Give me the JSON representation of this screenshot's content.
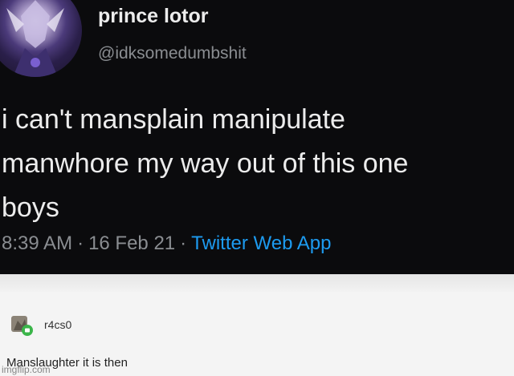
{
  "tweet": {
    "display_name": "prince lotor",
    "handle": "@idksomedumbshit",
    "text_lines": [
      "i can't mansplain manipulate",
      "manwhore my way out of this one",
      "boys"
    ],
    "time": "8:39 AM",
    "separator": "·",
    "date": "16 Feb 21",
    "source": "Twitter Web App",
    "avatar_icon": "profile-avatar-icon"
  },
  "comment": {
    "username": "r4cs0",
    "text": "Manslaughter it is then",
    "avatar_icon": "user-avatar-icon"
  },
  "watermark": "imgflip.com",
  "colors": {
    "tweet_bg": "#0b0b0d",
    "text": "#ececec",
    "muted": "#8a8d91",
    "link": "#1d9bf0",
    "comment_bg": "#f4f4f4"
  }
}
